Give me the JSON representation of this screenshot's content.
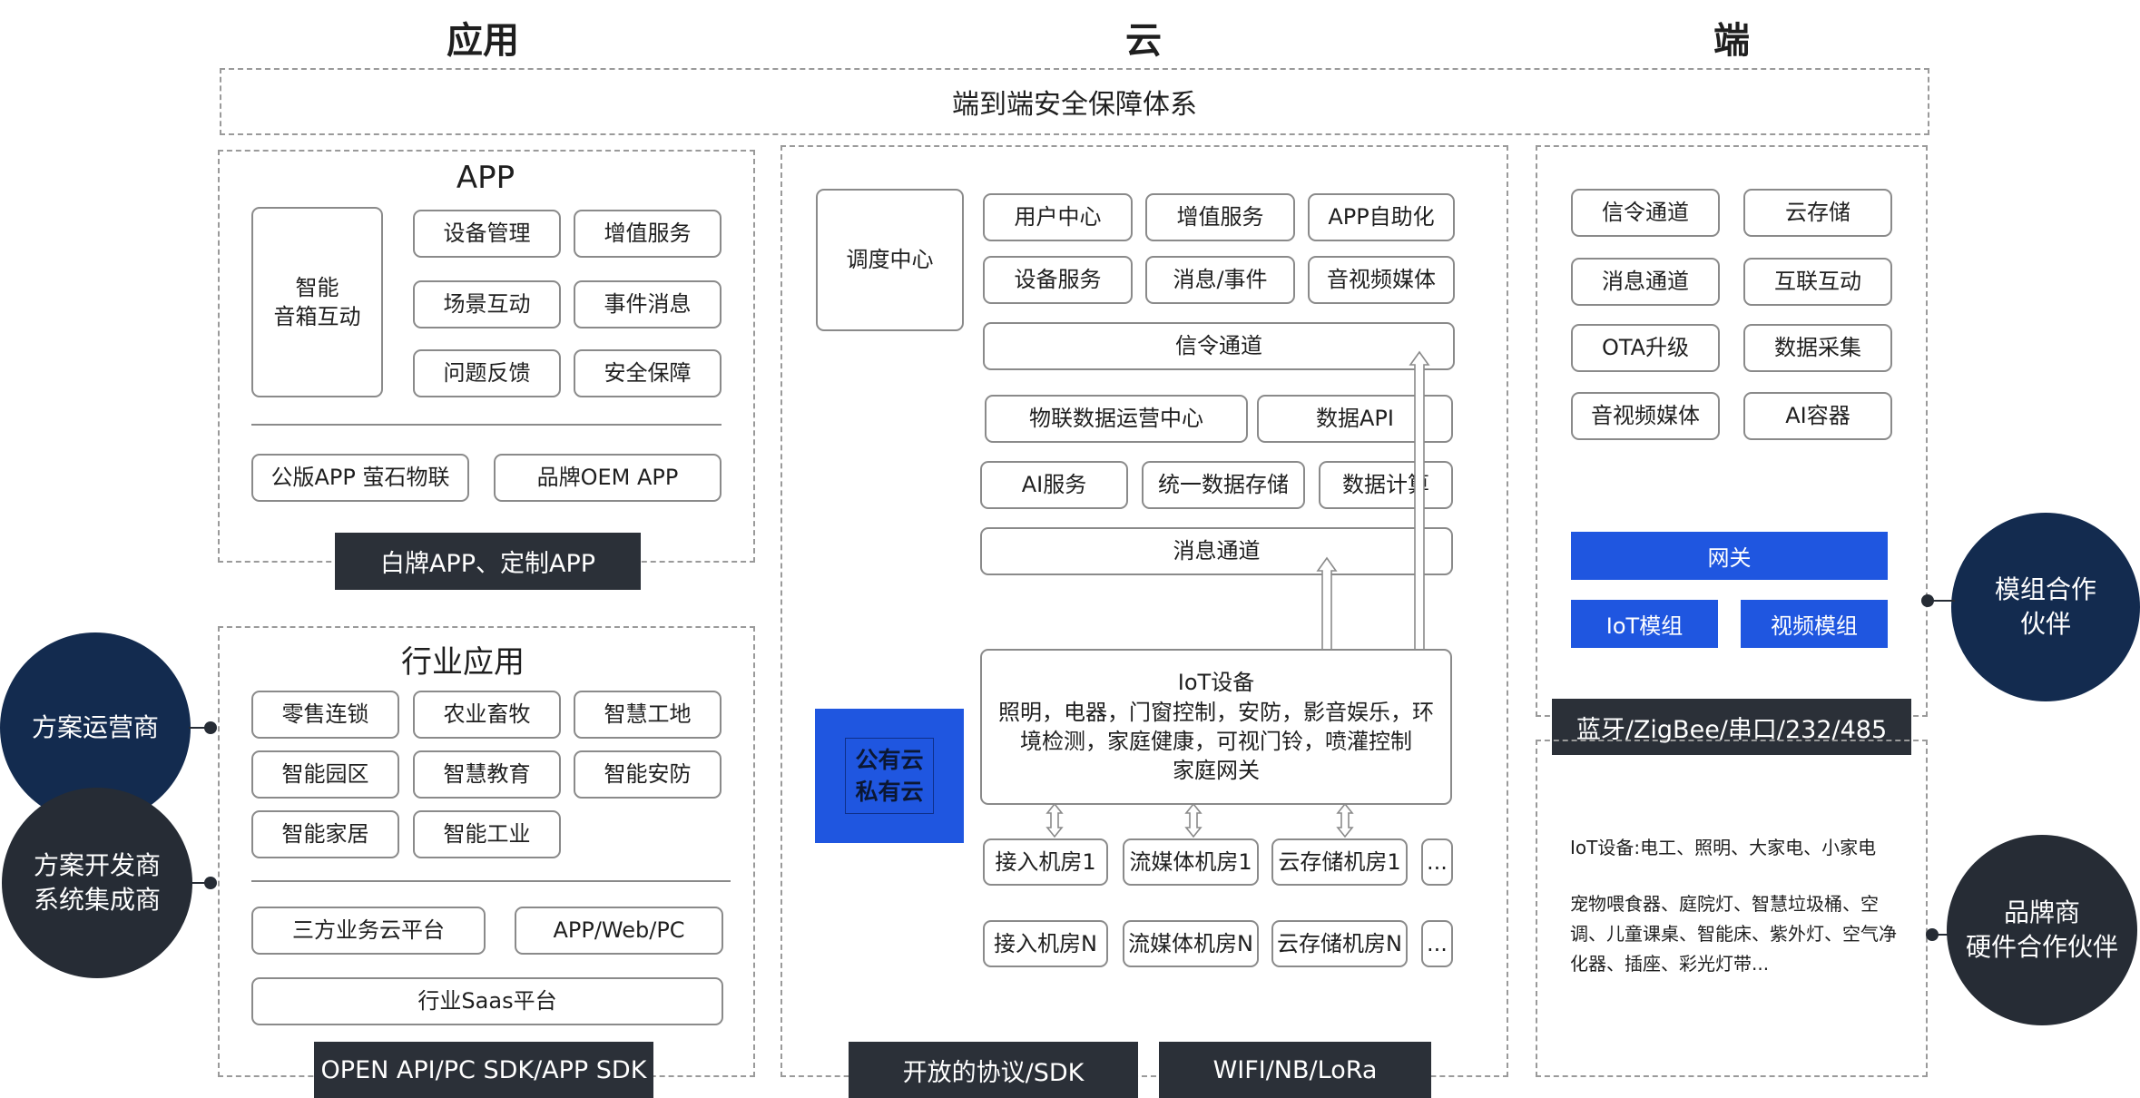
{
  "columns": {
    "app": "应用",
    "cloud": "云",
    "device": "端"
  },
  "security_bar": "端到端安全保障体系",
  "app_section": {
    "title": "APP",
    "voice_box": "智能\n音箱互动",
    "items": [
      "设备管理",
      "增值服务",
      "场景互动",
      "事件消息",
      "问题反馈",
      "安全保障"
    ],
    "apps": [
      "公版APP 萤石物联",
      "品牌OEM APP"
    ],
    "footer": "白牌APP、定制APP"
  },
  "industry_section": {
    "title": "行业应用",
    "items": [
      "零售连锁",
      "农业畜牧",
      "智慧工地",
      "智能园区",
      "智慧教育",
      "智能安防",
      "智能家居",
      "智能工业"
    ],
    "platforms": [
      "三方业务云平台",
      "APP/Web/PC"
    ],
    "saas": "行业Saas平台",
    "footer": "OPEN API/PC SDK/APP SDK"
  },
  "left_partners": [
    "方案运营商",
    "方案开发商\n系统集成商"
  ],
  "cloud_section": {
    "dispatch": "调度中心",
    "services": [
      "用户中心",
      "增值服务",
      "APP自助化",
      "设备服务",
      "消息/事件",
      "音视频媒体"
    ],
    "signal_channel": "信令通道",
    "data_row1": [
      "物联数据运营中心",
      "数据API"
    ],
    "data_row2": [
      "AI服务",
      "统一数据存储",
      "数据计算"
    ],
    "message_channel": "消息通道",
    "cloud_type": "公有云\n私有云",
    "iot_title": "IoT设备",
    "iot_desc": "照明，电器，门窗控制，安防，影音娱乐，环境检测，家庭健康，可视门铃，喷灌控制\n家庭网关",
    "rooms_row1": [
      "接入机房1",
      "流媒体机房1",
      "云存储机房1",
      "..."
    ],
    "rooms_row2": [
      "接入机房N",
      "流媒体机房N",
      "云存储机房N",
      "..."
    ],
    "footers": [
      "开放的协议/SDK",
      "WIFI/NB/LoRa"
    ]
  },
  "device_section": {
    "items": [
      "信令通道",
      "云存储",
      "消息通道",
      "互联互动",
      "OTA升级",
      "数据采集",
      "音视频媒体",
      "AI容器"
    ],
    "gateway": "网关",
    "modules": [
      "IoT模组",
      "视频模组"
    ],
    "protocol_bar": "蓝牙/ZigBee/串口/232/485",
    "iot_line": "IoT设备:电工、照明、大家电、小家电",
    "examples": "宠物喂食器、庭院灯、智慧垃圾桶、空调、儿童课桌、智能床、紫外灯、空气净化器、插座、彩光灯带..."
  },
  "right_partners": [
    "模组合作\n伙伴",
    "品牌商\n硬件合作伙伴"
  ],
  "colors": {
    "dark_label": "#2b3038",
    "blue": "#1f56e0",
    "navy": "#132b4f",
    "charcoal": "#262c35"
  }
}
